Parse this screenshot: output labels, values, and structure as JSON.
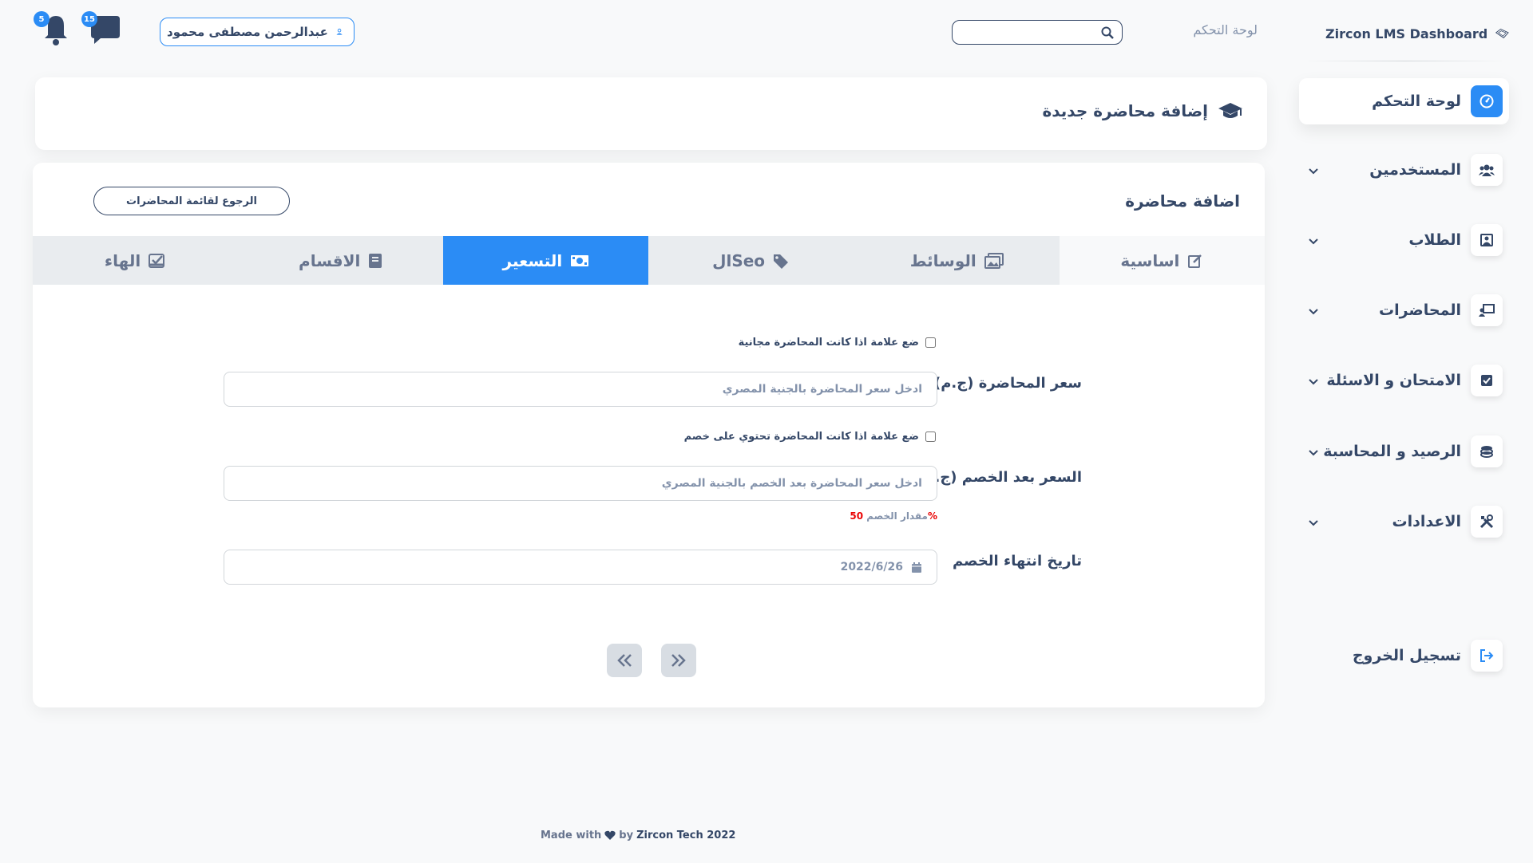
{
  "brand": {
    "name": "Zircon LMS Dashboard"
  },
  "topbar": {
    "breadcrumb": "لوحة التحكم",
    "search_placeholder": "",
    "user_name": "عبدالرحمن مصطفى محمود",
    "messages_count": "15",
    "notifications_count": "5"
  },
  "sidebar": {
    "items": [
      {
        "label": "لوحة التحكم",
        "icon": "dashboard-icon"
      },
      {
        "label": "المستخدمين",
        "icon": "users-icon"
      },
      {
        "label": "الطلاب",
        "icon": "student-icon"
      },
      {
        "label": "المحاضرات",
        "icon": "lecture-icon"
      },
      {
        "label": "الامتحان و الاسئلة",
        "icon": "exam-icon"
      },
      {
        "label": "الرصيد و المحاسبة",
        "icon": "coins-icon"
      },
      {
        "label": "الاعدادات",
        "icon": "tools-icon"
      }
    ],
    "logout_label": "تسجيل الخروج"
  },
  "header": {
    "title": "إضافة محاضرة جديدة"
  },
  "main": {
    "title": "اضافة محاضرة",
    "back_button": "الرجوع لقائمة المحاضرات",
    "tabs": [
      {
        "label": "اساسية",
        "icon": "edit-icon"
      },
      {
        "label": "الوسائط",
        "icon": "images-icon"
      },
      {
        "label": "الSeo",
        "icon": "tags-icon"
      },
      {
        "label": "التسعير",
        "icon": "money-icon"
      },
      {
        "label": "الاقسام",
        "icon": "book-icon"
      },
      {
        "label": "الهاء",
        "icon": "check-square-icon"
      }
    ],
    "active_tab": "التسعير",
    "free_checkbox_label": "ضع علامة اذا كانت المحاضرة مجانية",
    "price_label": "سعر المحاضرة (ج.م)",
    "price_placeholder": "ادخل سعر المحاضرة بالجنية المصري",
    "discount_checkbox_label": "ضع علامة اذا كانت المحاضرة تحتوي على خصم",
    "discount_price_label": "السعر بعد الخصم (ج.م)",
    "discount_price_placeholder": "ادخل سعر المحاضرة بعد الخصم بالجنية المصري",
    "discount_amount_label": "مقدار الخصم",
    "discount_amount_value": "50%",
    "discount_end_label": "تاريخ انتهاء الخصم",
    "discount_end_value": "2022/6/26"
  },
  "footer": {
    "made_with": "Made with",
    "by": "by",
    "company": "Zircon Tech 2022"
  },
  "colors": {
    "accent": "#2b8cf5",
    "text": "#344767",
    "muted": "#8392ab",
    "danger": "#ea0606"
  }
}
